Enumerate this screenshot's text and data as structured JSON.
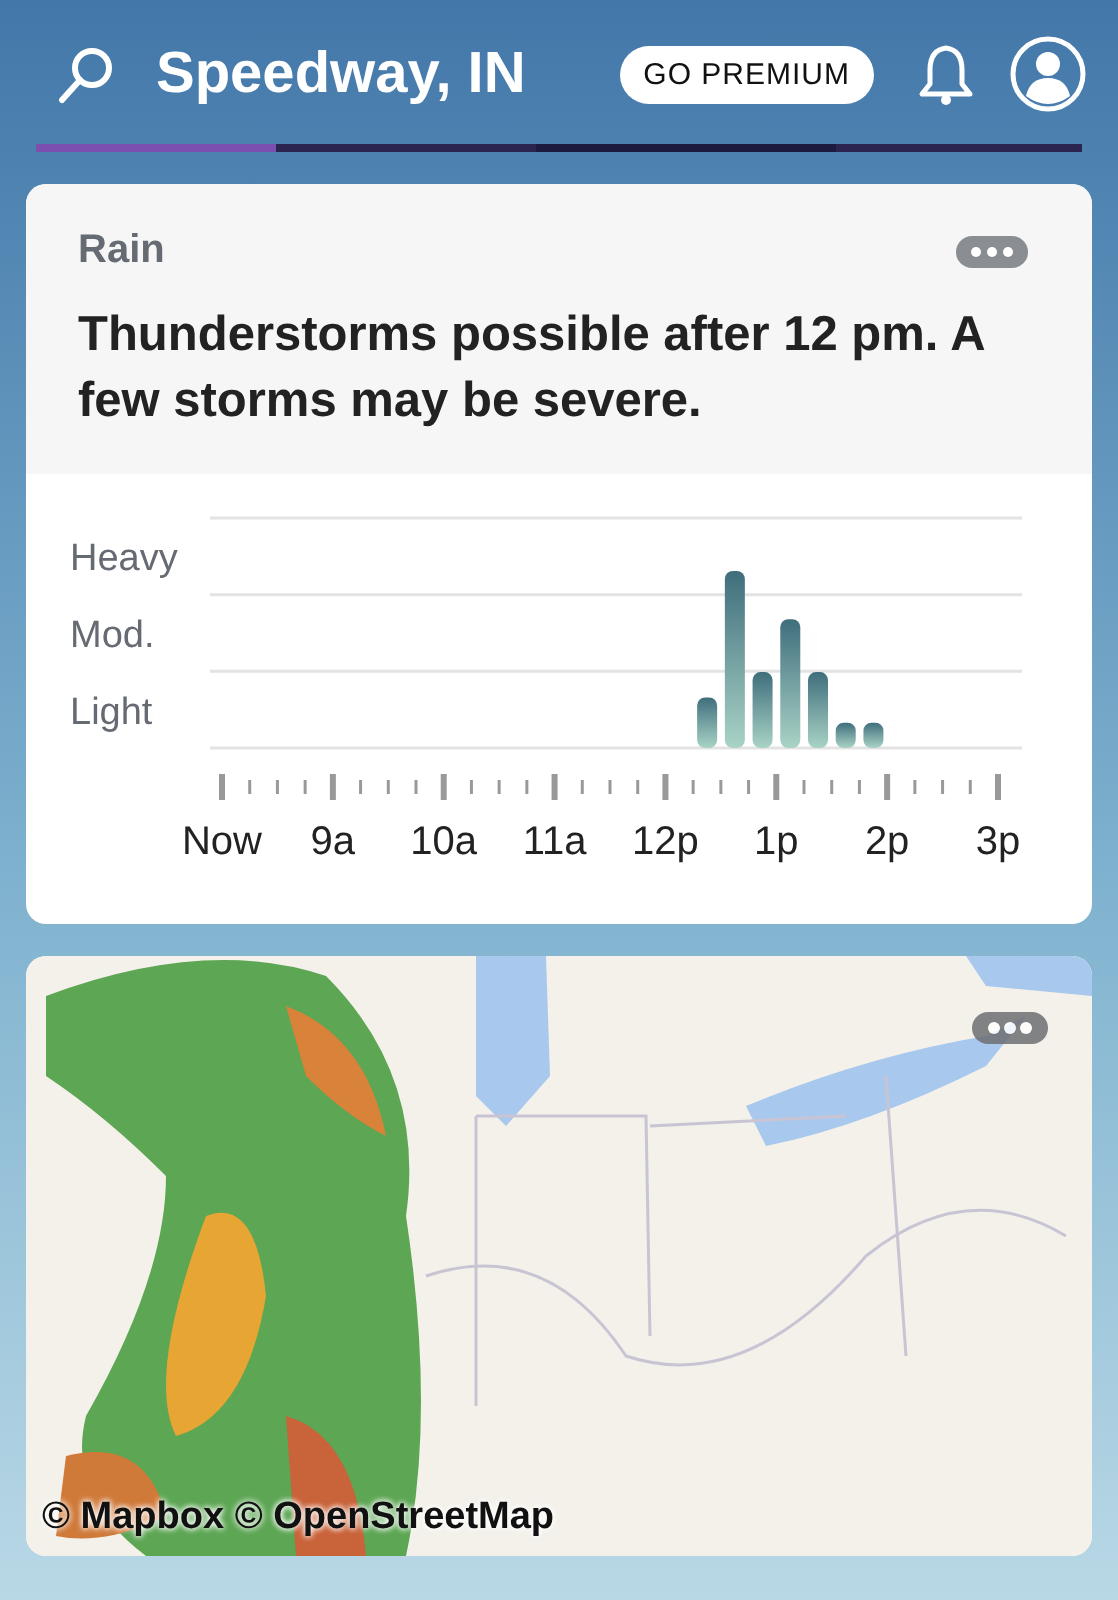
{
  "header": {
    "title": "Speedway, IN",
    "premium_button": "GO PREMIUM"
  },
  "rain_card": {
    "label": "Rain",
    "headline": "Thunderstorms possible after 12 pm. A few storms may be severe.",
    "levels": [
      "Heavy",
      "Mod.",
      "Light"
    ],
    "time_labels": [
      "Now",
      "9a",
      "10a",
      "11a",
      "12p",
      "1p",
      "2p",
      "3p"
    ]
  },
  "map": {
    "kind": "picture",
    "attribution": "© Mapbox © OpenStreetMap"
  }
}
